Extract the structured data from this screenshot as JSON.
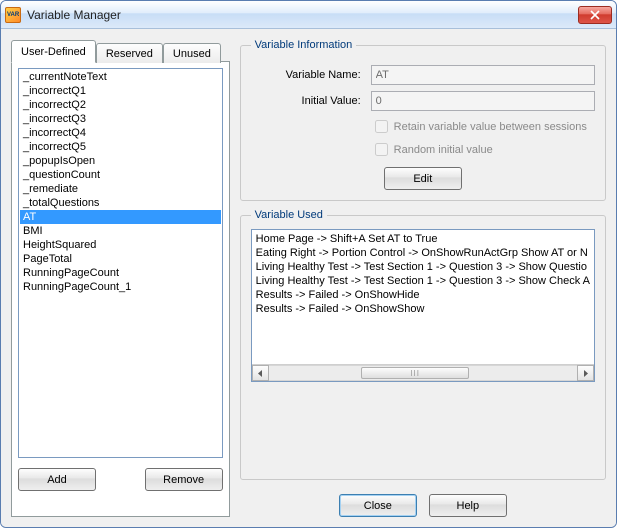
{
  "window": {
    "title": "Variable Manager"
  },
  "tabs": {
    "user_defined": "User-Defined",
    "reserved": "Reserved",
    "unused": "Unused"
  },
  "variables": [
    "_currentNoteText",
    "_incorrectQ1",
    "_incorrectQ2",
    "_incorrectQ3",
    "_incorrectQ4",
    "_incorrectQ5",
    "_popupIsOpen",
    "_questionCount",
    "_remediate",
    "_totalQuestions",
    "AT",
    "BMI",
    "HeightSquared",
    "PageTotal",
    "RunningPageCount",
    "RunningPageCount_1"
  ],
  "selected_variable": "AT",
  "buttons": {
    "add": "Add",
    "remove": "Remove",
    "edit": "Edit",
    "close": "Close",
    "help": "Help"
  },
  "info": {
    "group_title": "Variable Information",
    "name_label": "Variable Name:",
    "name_value": "AT",
    "initial_label": "Initial Value:",
    "initial_value": "0",
    "retain_label": "Retain variable value between sessions",
    "random_label": "Random initial value"
  },
  "used": {
    "group_title": "Variable Used",
    "lines": [
      "Home Page -> Shift+A Set AT to True",
      "Eating Right -> Portion Control -> OnShowRunActGrp Show AT or N",
      "Living Healthy Test -> Test Section 1 -> Question 3 -> Show Questio",
      "Living Healthy Test -> Test Section 1 -> Question 3 -> Show Check A",
      "Results -> Failed -> OnShowHide",
      "Results -> Failed -> OnShowShow"
    ]
  }
}
